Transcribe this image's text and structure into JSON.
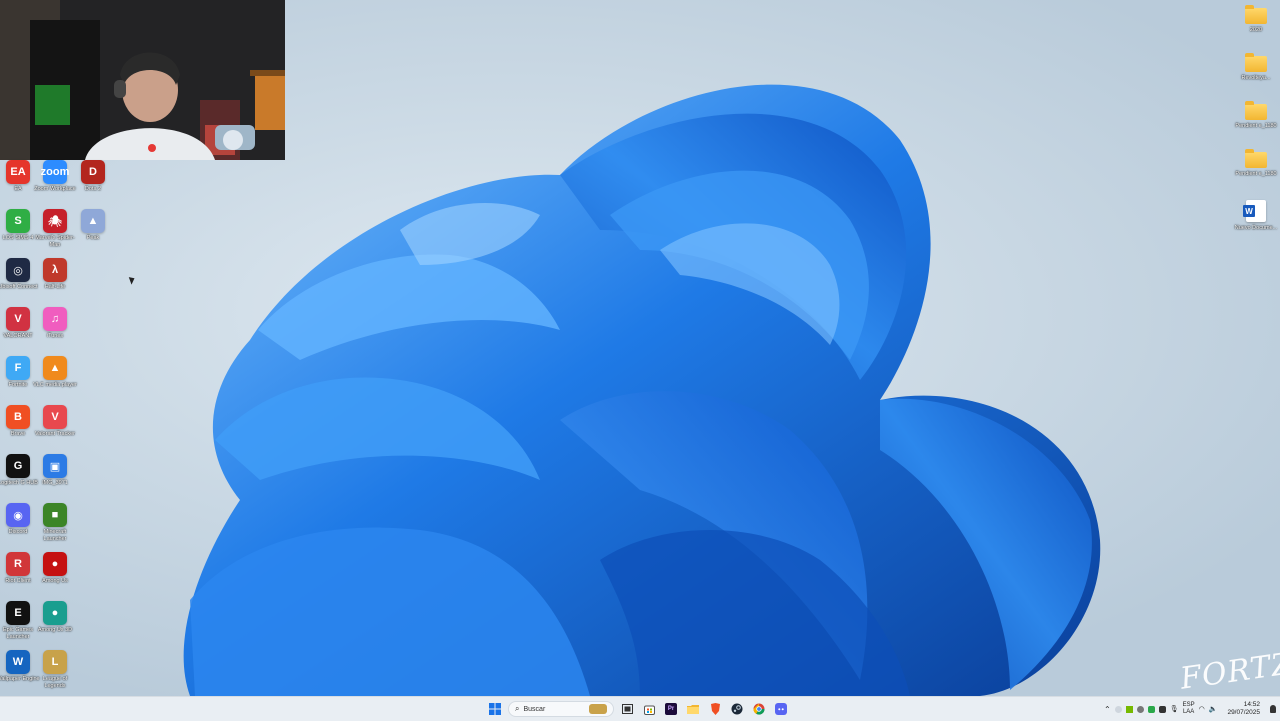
{
  "desktop": {
    "left_icons": [
      {
        "label": "EA",
        "color": "#e5352b",
        "glyph": "EA"
      },
      {
        "label": "Zoom Workplace",
        "color": "#2d8cff",
        "glyph": "zoom"
      },
      {
        "label": "Dota 2",
        "color": "#b3261e",
        "glyph": "D"
      },
      {
        "label": "LOS SIMS 4",
        "color": "#2fae45",
        "glyph": "S"
      },
      {
        "label": "Marvel's Spider-Man",
        "color": "#c6202a",
        "glyph": "🕷"
      },
      {
        "label": "Peak",
        "color": "#8fa8d8",
        "glyph": "▲"
      },
      {
        "label": "Ubisoft Connect",
        "color": "#1f2a44",
        "glyph": "◎"
      },
      {
        "label": "Half-Life",
        "color": "#c0392b",
        "glyph": "λ"
      },
      {
        "label": "VALORANT",
        "color": "#d13242",
        "glyph": "V"
      },
      {
        "label": "iTunes",
        "color": "#f05dbf",
        "glyph": "♫"
      },
      {
        "label": "Fortnite",
        "color": "#3fa9f5",
        "glyph": "F"
      },
      {
        "label": "VLC media player",
        "color": "#f08a1c",
        "glyph": "▲"
      },
      {
        "label": "Brave",
        "color": "#f04f23",
        "glyph": "B"
      },
      {
        "label": "Valorant Tracker",
        "color": "#e8484e",
        "glyph": "V"
      },
      {
        "label": "Logitech G HUB",
        "color": "#111111",
        "glyph": "G"
      },
      {
        "label": "IMG_3971",
        "color": "#2c7be5",
        "glyph": "▣"
      },
      {
        "label": "Discord",
        "color": "#5865f2",
        "glyph": "◉"
      },
      {
        "label": "Minecraft Launcher",
        "color": "#3c8527",
        "glyph": "■"
      },
      {
        "label": "Riot Client",
        "color": "#d13639",
        "glyph": "R"
      },
      {
        "label": "Among Us",
        "color": "#c51111",
        "glyph": "●"
      },
      {
        "label": "Epic Games Launcher",
        "color": "#111111",
        "glyph": "E"
      },
      {
        "label": "Among Us 3D",
        "color": "#1a9e8f",
        "glyph": "●"
      },
      {
        "label": "Wallpaper Engine",
        "color": "#1565c0",
        "glyph": "W"
      },
      {
        "label": "League of Legends",
        "color": "#c8a24a",
        "glyph": "L"
      }
    ],
    "right_icons": [
      {
        "label": "2020",
        "type": "folder"
      },
      {
        "label": "Revolteya...",
        "type": "folder"
      },
      {
        "label": "Pendient e_1180",
        "type": "folder"
      },
      {
        "label": "Pendient e_1180",
        "type": "folder"
      },
      {
        "label": "Nuevo Docume...",
        "type": "word"
      }
    ],
    "watermark": "FORTZ"
  },
  "taskbar": {
    "search_placeholder": "Buscar",
    "lang_top": "ESP",
    "lang_bottom": "LAA",
    "time": "14:52",
    "date": "29/07/2025"
  },
  "colors": {
    "bloom_dark": "#0d4fb8",
    "bloom_mid": "#1f7ae6",
    "bloom_light": "#5fb2ff",
    "taskbar": "#e9eef3"
  }
}
